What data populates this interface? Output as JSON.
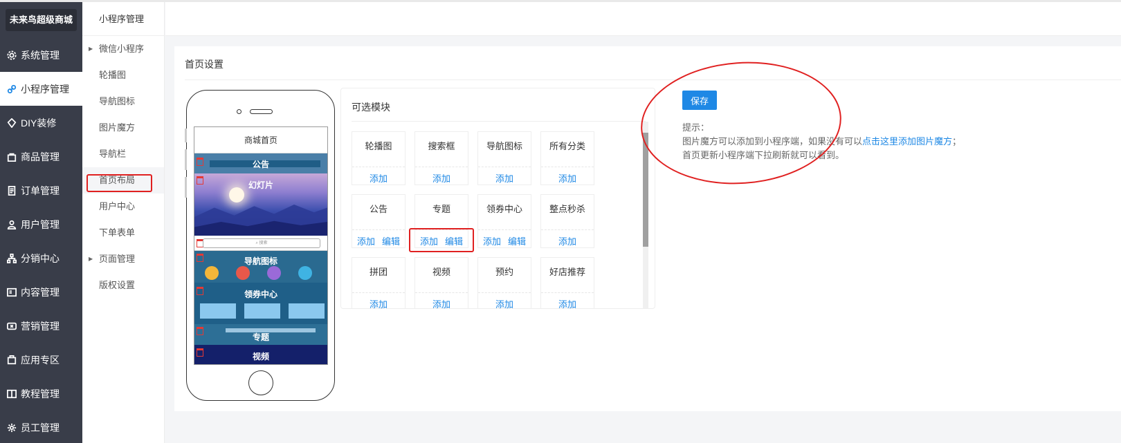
{
  "brand": "未来鸟超级商城",
  "sidebar": {
    "items": [
      {
        "label": "系统管理",
        "icon": "gear-icon"
      },
      {
        "label": "小程序管理",
        "icon": "link-icon"
      },
      {
        "label": "DIY装修",
        "icon": "diy-icon"
      },
      {
        "label": "商品管理",
        "icon": "bag-icon"
      },
      {
        "label": "订单管理",
        "icon": "order-icon"
      },
      {
        "label": "用户管理",
        "icon": "user-icon"
      },
      {
        "label": "分销中心",
        "icon": "network-icon"
      },
      {
        "label": "内容管理",
        "icon": "content-icon"
      },
      {
        "label": "营销管理",
        "icon": "ticket-icon"
      },
      {
        "label": "应用专区",
        "icon": "app-icon"
      },
      {
        "label": "教程管理",
        "icon": "book-icon"
      },
      {
        "label": "员工管理",
        "icon": "settings-icon"
      }
    ],
    "active": "小程序管理"
  },
  "submenu": {
    "title": "小程序管理",
    "items": [
      {
        "label": "微信小程序",
        "arrow": true
      },
      {
        "label": "轮播图"
      },
      {
        "label": "导航图标"
      },
      {
        "label": "图片魔方"
      },
      {
        "label": "导航栏"
      },
      {
        "label": "首页布局"
      },
      {
        "label": "用户中心"
      },
      {
        "label": "下单表单"
      },
      {
        "label": "页面管理",
        "arrow": true
      },
      {
        "label": "版权设置"
      }
    ],
    "active": "首页布局"
  },
  "panel": {
    "title": "首页设置"
  },
  "phone": {
    "screen_title": "商城首页",
    "modules": {
      "notice": "公告",
      "slide": "幻灯片",
      "search": "搜索",
      "nav": "导航图标",
      "coupon": "领券中心",
      "topic": "专题",
      "video": "视频"
    }
  },
  "modules_panel": {
    "title": "可选模块",
    "add_label": "添加",
    "edit_label": "编辑",
    "cards": [
      {
        "name": "轮播图",
        "edit": false
      },
      {
        "name": "搜索框",
        "edit": false
      },
      {
        "name": "导航图标",
        "edit": false
      },
      {
        "name": "所有分类",
        "edit": false
      },
      {
        "name": "公告",
        "edit": true
      },
      {
        "name": "专题",
        "edit": true
      },
      {
        "name": "领券中心",
        "edit": true
      },
      {
        "name": "整点秒杀",
        "edit": false
      },
      {
        "name": "拼团",
        "edit": false
      },
      {
        "name": "视频",
        "edit": false
      },
      {
        "name": "预约",
        "edit": false
      },
      {
        "name": "好店推荐",
        "edit": false
      }
    ]
  },
  "save_label": "保存",
  "tips": {
    "heading": "提示：",
    "line1_pre": "图片魔方可以添加到小程序端，如果没有可以",
    "line1_link": "点击这里添加图片魔方",
    "line1_post": "；",
    "line2": "首页更新小程序端下拉刷新就可以看到。"
  },
  "colors": {
    "accent": "#1e88e5",
    "sidebar_bg": "#393d49",
    "annotation_red": "#e02020"
  }
}
